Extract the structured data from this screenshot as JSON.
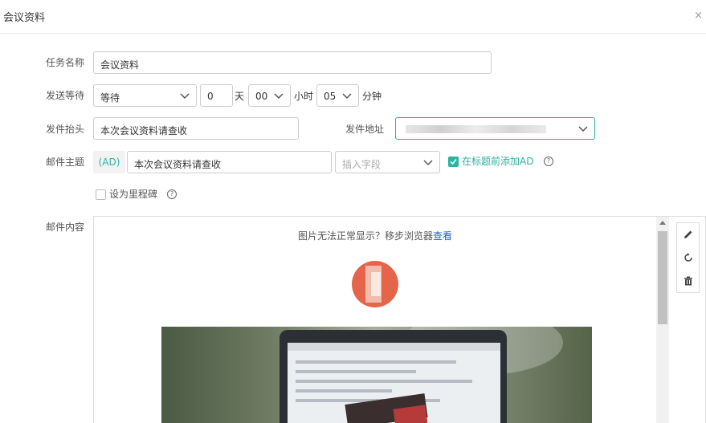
{
  "dialog": {
    "title": "会议资料",
    "close_glyph": "×"
  },
  "labels": {
    "task_name": "任务名称",
    "send_wait": "发送等待",
    "header": "发件抬头",
    "address": "发件地址",
    "subject": "邮件主题",
    "content": "邮件内容"
  },
  "task_name": {
    "value": "会议资料"
  },
  "send_wait": {
    "mode": "等待",
    "days": "0",
    "days_unit": "天",
    "hours": "00",
    "hours_unit": "小时",
    "minutes": "05",
    "minutes_unit": "分钟"
  },
  "header_field": {
    "value": "本次会议资料请查收"
  },
  "subject": {
    "ad_tag": "(AD)",
    "value": "本次会议资料请查收",
    "insert_placeholder": "插入字段",
    "add_ad_label": "在标题前添加AD",
    "add_ad_checked": true
  },
  "milestone": {
    "label": "设为里程碑",
    "checked": false
  },
  "editor": {
    "notice": "图片无法正常显示？移步浏览器",
    "notice_link": "查看"
  },
  "tools": [
    "edit-icon",
    "refresh-icon",
    "trash-icon"
  ],
  "colors": {
    "accent": "#2bb3a3",
    "link": "#1f5fd1",
    "avatar": "#e4654a"
  }
}
